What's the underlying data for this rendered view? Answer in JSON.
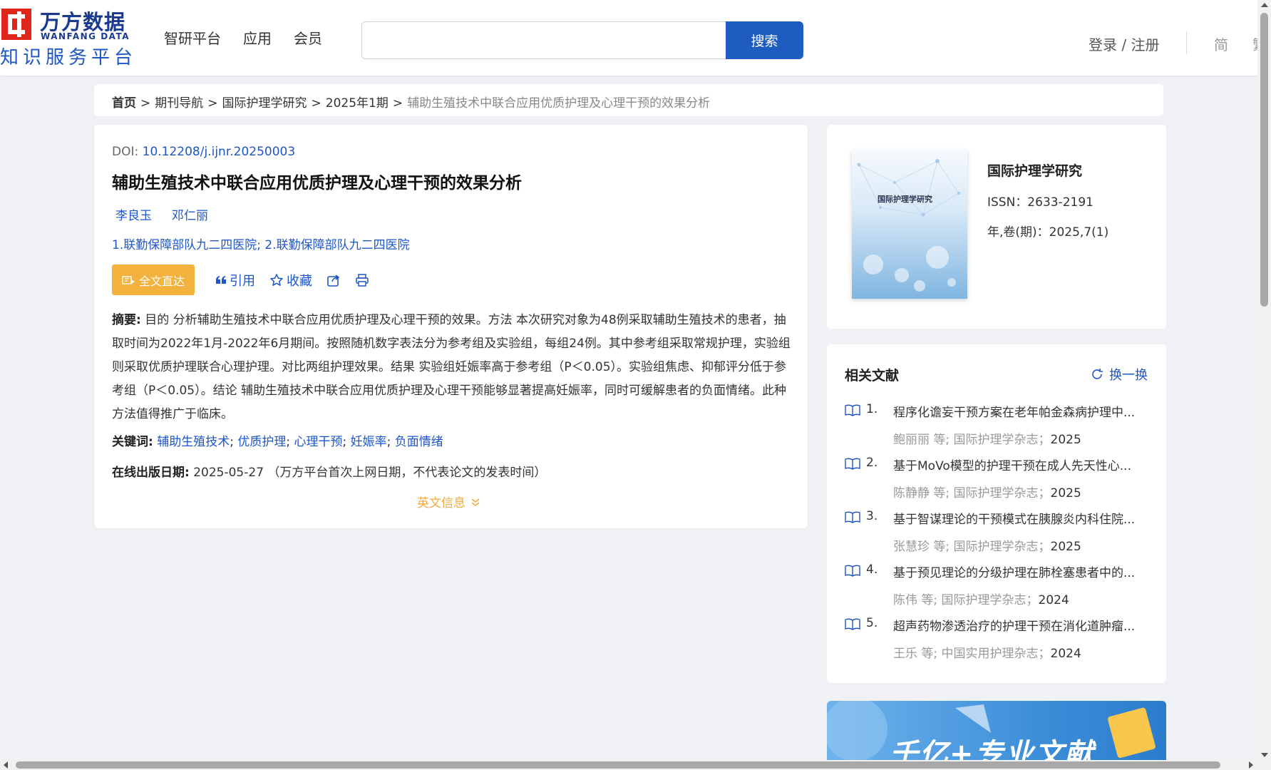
{
  "header": {
    "logo": {
      "cn": "万方数据",
      "en": "WANFANG DATA",
      "sub": "知识服务平台"
    },
    "nav": [
      "智研平台",
      "应用",
      "会员"
    ],
    "search": {
      "value": "",
      "placeholder": "",
      "button": "搜索"
    },
    "login": "登录 / 注册",
    "lang_simple": "简",
    "lang_trad": "繁"
  },
  "breadcrumb": {
    "home": "首页",
    "items": [
      "期刊导航",
      "国际护理学研究",
      "2025年1期"
    ],
    "current": "辅助生殖技术中联合应用优质护理及心理干预的效果分析",
    "sep": ">"
  },
  "article": {
    "doi_label": "DOI:",
    "doi": "10.12208/j.ijnr.20250003",
    "title": "辅助生殖技术中联合应用优质护理及心理干预的效果分析",
    "authors": [
      "李良玉",
      "邓仁丽"
    ],
    "affiliations": "1.联勤保障部队九二四医院; 2.联勤保障部队九二四医院",
    "fulltext_btn": "全文直达",
    "actions": {
      "cite": "引用",
      "fav": "收藏"
    },
    "abstract_label": "摘要:",
    "abstract": "目的 分析辅助生殖技术中联合应用优质护理及心理干预的效果。方法 本次研究对象为48例采取辅助生殖技术的患者，抽取时间为2022年1月-2022年6月期间。按照随机数字表法分为参考组及实验组，每组24例。其中参考组采取常规护理，实验组则采取优质护理联合心理护理。对比两组护理效果。结果 实验组妊娠率高于参考组（P＜0.05）。实验组焦虑、抑郁评分低于参考组（P＜0.05）。结论 辅助生殖技术中联合应用优质护理及心理干预能够显著提高妊娠率，同时可缓解患者的负面情绪。此种方法值得推广于临床。",
    "keywords_label": "关键词:",
    "keywords": [
      "辅助生殖技术",
      "优质护理",
      "心理干预",
      "妊娠率",
      "负面情绪"
    ],
    "pubdate_label": "在线出版日期:",
    "pubdate": "2025-05-27",
    "pubdate_note": "（万方平台首次上网日期，不代表论文的发表时间）",
    "english_toggle": "英文信息"
  },
  "journal": {
    "cover_title": "国际护理学研究",
    "name": "国际护理学研究",
    "issn": "ISSN：2633-2191",
    "volume": "年,卷(期)：2025,7(1)"
  },
  "related": {
    "title": "相关文献",
    "refresh": "换一换",
    "items": [
      {
        "num": "1.",
        "title": "程序化谵妄干预方案在老年帕金森病护理中...",
        "author": "鲍丽丽",
        "etal": "等;",
        "journal": "国际护理学杂志；",
        "year": "2025"
      },
      {
        "num": "2.",
        "title": "基于MoVo模型的护理干预在成人先天性心...",
        "author": "陈静静",
        "etal": "等;",
        "journal": "国际护理学杂志；",
        "year": "2025"
      },
      {
        "num": "3.",
        "title": "基于智谋理论的干预模式在胰腺炎内科住院...",
        "author": "张慧珍",
        "etal": "等;",
        "journal": "国际护理学杂志；",
        "year": "2025"
      },
      {
        "num": "4.",
        "title": "基于预见理论的分级护理在肺栓塞患者中的...",
        "author": "陈伟",
        "etal": "等;",
        "journal": "国际护理学杂志；",
        "year": "2024"
      },
      {
        "num": "5.",
        "title": "超声药物渗透治疗的护理干预在消化道肿瘤...",
        "author": "王乐",
        "etal": "等;",
        "journal": "中国实用护理杂志；",
        "year": "2024"
      }
    ]
  },
  "banner": {
    "text": "千亿+专业文献"
  },
  "colors": {
    "brand_blue": "#1f5cc1",
    "link_blue": "#1e56c9",
    "accent_orange": "#f3b23b",
    "logo_red": "#e0261b"
  },
  "icons": [
    "logo-mark",
    "quote-icon",
    "star-icon",
    "share-icon",
    "print-icon",
    "chevron-down-icon",
    "refresh-icon",
    "book-icon",
    "fulltext-icon"
  ]
}
